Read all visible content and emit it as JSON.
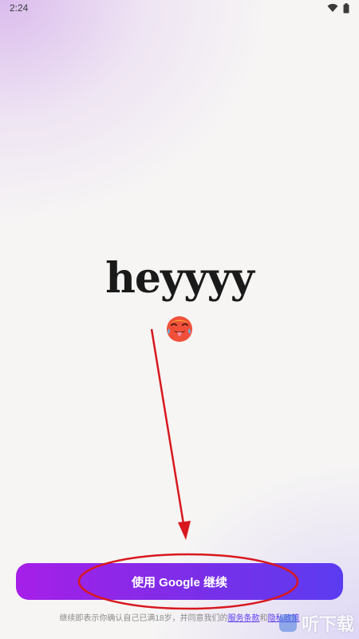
{
  "status_bar": {
    "time": "2:24",
    "icons": [
      "wifi-icon",
      "battery-icon"
    ]
  },
  "app": {
    "logo_text": "heyyyy",
    "emoji": "hot-face-emoji"
  },
  "cta": {
    "label": "使用 Google 继续"
  },
  "legal": {
    "prefix": "继续即表示你确认自己已满18岁，并同意我们的",
    "terms": "服务条款",
    "and": "和",
    "privacy": "隐私政策"
  },
  "watermark": {
    "text": "听下载"
  },
  "colors": {
    "cta_start": "#a61fe8",
    "cta_end": "#5b3cf0",
    "annotation_red": "#d8181e"
  }
}
